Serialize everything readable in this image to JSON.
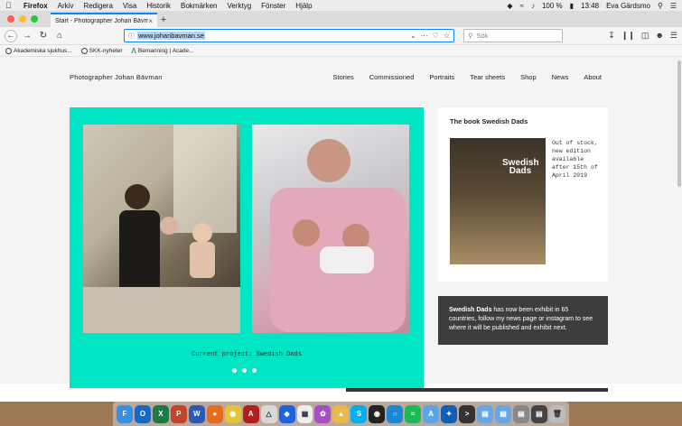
{
  "menubar": {
    "app": "Firefox",
    "items": [
      "Arkiv",
      "Redigera",
      "Visa",
      "Historik",
      "Bokmärken",
      "Verktyg",
      "Fönster",
      "Hjälp"
    ],
    "battery": "100 %",
    "time": "13:48",
    "user": "Eva Gärdsmo"
  },
  "tab": {
    "title": "Start - Photographer Johan Bävman"
  },
  "url": "www.johanbavman.se",
  "search_placeholder": "Sök",
  "bookmarks": [
    "Akademiska sjukhus...",
    "SKK-nyheter",
    "Bemanning | Acade..."
  ],
  "site": {
    "title": "Photographer Johan Bävman",
    "nav": [
      "Stories",
      "Commissioned",
      "Portraits",
      "Tear sheets",
      "Shop",
      "News",
      "About"
    ],
    "hero_caption": "Current project: Swedish Dads",
    "book_title": "The book Swedish Dads",
    "book_cover_text": "Swedish Dads",
    "book_note": "Out of stock, new edition available after 15th of April 2019",
    "banner_bold": "Swedish Dads",
    "banner_text": " has now been exhibit in 65 countries, follow my news page or instagram to see where it will be published and exhibit next."
  },
  "colors": {
    "hero": "#00e5c4",
    "banner": "#3d3d3d",
    "accent": "#0a84ff"
  }
}
